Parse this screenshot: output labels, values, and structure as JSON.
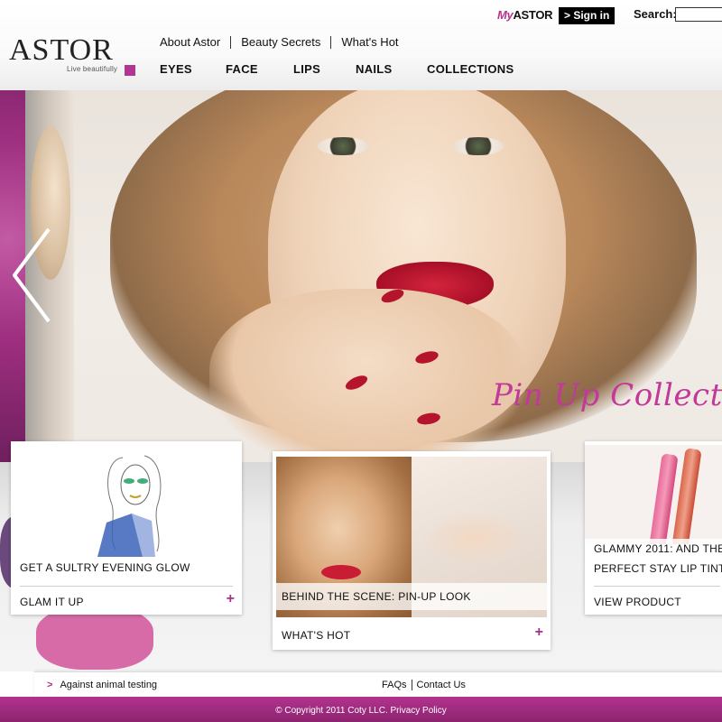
{
  "header": {
    "myastor_prefix": "My",
    "myastor_brand": "ASTOR",
    "signin_label": "> Sign in",
    "search_label": "Search:",
    "search_value": "",
    "logo_text": "ASTOR",
    "logo_tagline": "Live beautifully"
  },
  "topnav": [
    "About Astor",
    "Beauty Secrets",
    "What's Hot"
  ],
  "mainnav": [
    "EYES",
    "FACE",
    "LIPS",
    "NAILS",
    "COLLECTIONS"
  ],
  "hero": {
    "caption": "Pin Up Collection"
  },
  "cards": {
    "card1": {
      "title": "GET A SULTRY EVENING GLOW",
      "link": "GLAM IT UP",
      "plus": "+"
    },
    "card2": {
      "overlay": "BEHIND THE SCENE: PIN-UP LOOK",
      "link": "WHAT'S HOT",
      "plus": "+"
    },
    "card3": {
      "title_line1": "GLAMMY 2011: AND THE",
      "title_line2": "PERFECT STAY LIP TINT!!",
      "link": "VIEW PRODUCT"
    }
  },
  "footer": {
    "left_arrow": ">",
    "left_text": "Against animal testing",
    "links": [
      "FAQs",
      "Contact Us"
    ],
    "copyright": "© Copyright 2011 Coty LLC. Privacy Policy"
  },
  "colors": {
    "accent": "#b0378f",
    "signin_bg": "#000000",
    "pinup_text": "#c2399a"
  }
}
